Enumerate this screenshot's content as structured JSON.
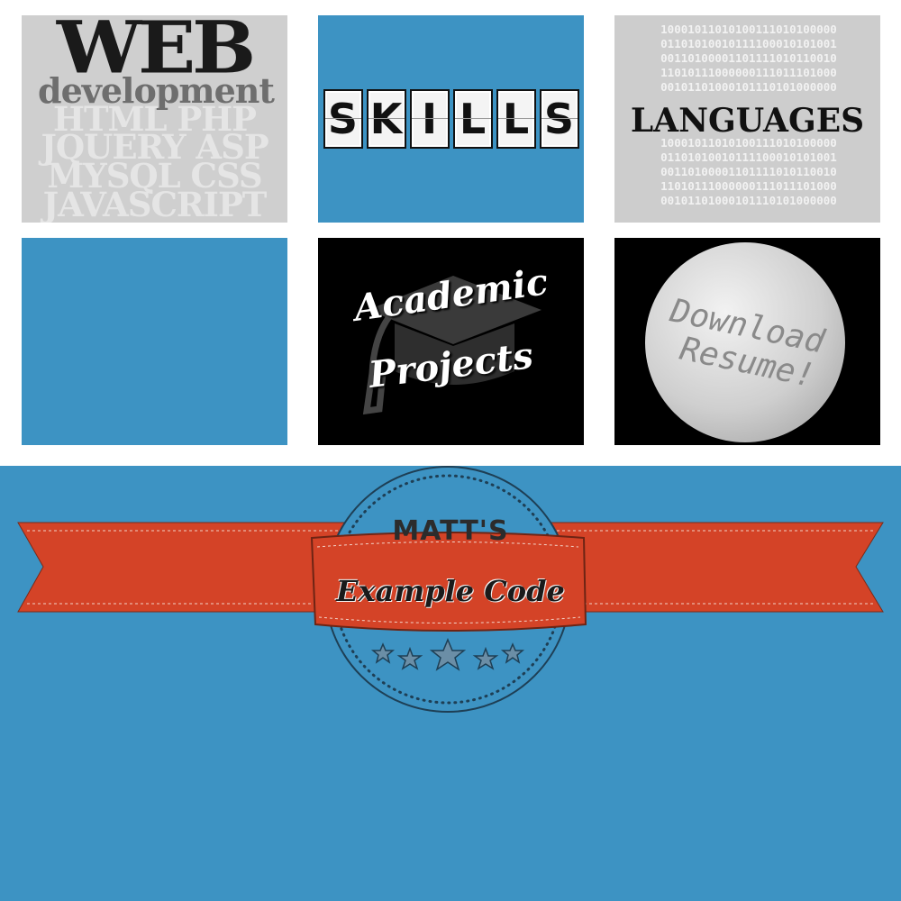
{
  "tiles": {
    "web": {
      "title": "WEB",
      "subtitle": "development",
      "languages": [
        "HTML PHP",
        "JQUERY ASP",
        "MYSQL CSS",
        "JAVASCRIPT"
      ]
    },
    "skills": {
      "letters": [
        "S",
        "K",
        "I",
        "L",
        "L",
        "S"
      ]
    },
    "languages": {
      "title": "LANGUAGES",
      "binary_top": [
        "10001011010100111010100000",
        "01101010010111100010101001",
        "00110100001101111010110010",
        "11010111000000111011101000",
        "00101101000101110101000000"
      ],
      "binary_bottom": [
        "10001011010100111010100000",
        "01101010010111100010101001",
        "00110100001101111010110010",
        "11010111000000111011101000",
        "00101101000101110101000000"
      ]
    },
    "academic": {
      "line1": "Academic",
      "line2": "Projects"
    },
    "resume": {
      "line1": "Download",
      "line2": "Resume!"
    }
  },
  "badge": {
    "name": "MATT'S",
    "tagline": "Example Code"
  },
  "colors": {
    "blue": "#3d93c3",
    "ribbon": "#d44327",
    "grey": "#cfcfcf"
  }
}
